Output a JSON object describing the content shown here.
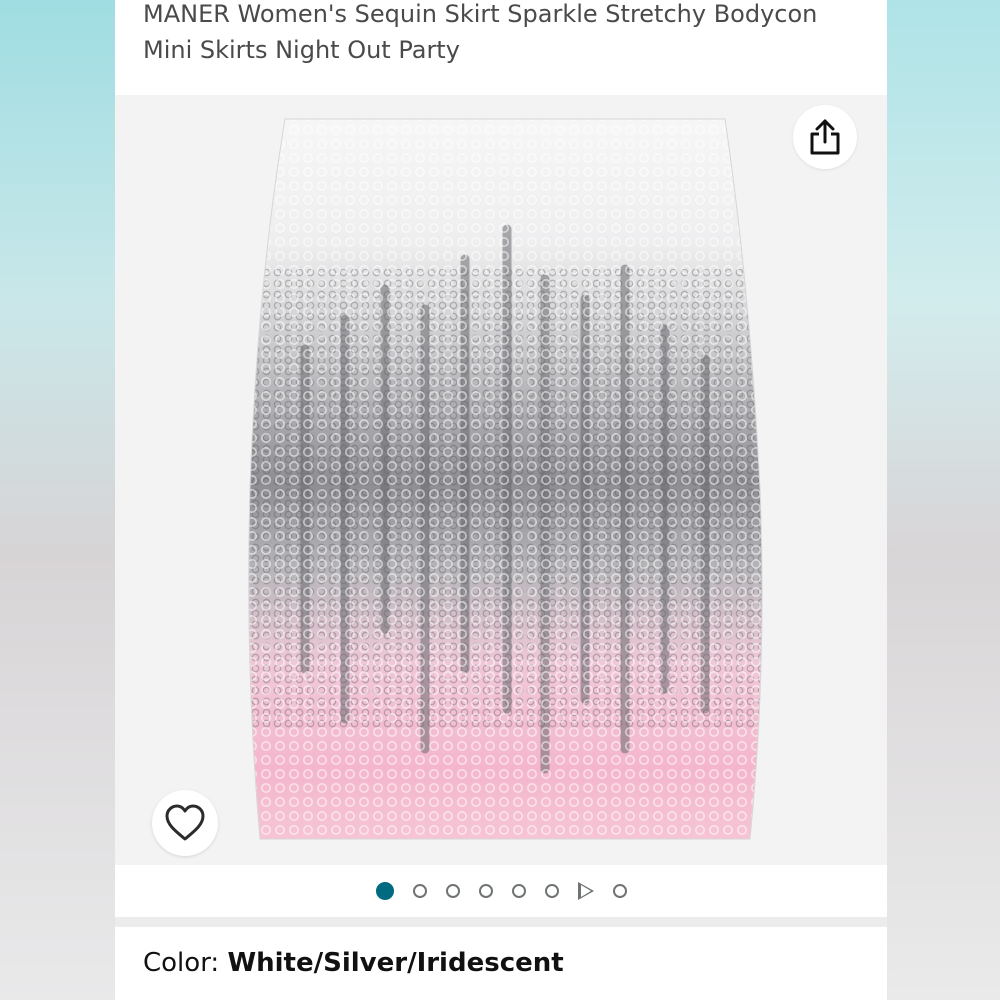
{
  "product": {
    "title": "MANER Women's Sequin Skirt Sparkle Stretchy Bodycon Mini Skirts Night Out Party"
  },
  "gallery": {
    "image_count": 7,
    "active_index": 0,
    "has_video": true,
    "share_icon": "share-icon",
    "wishlist_icon": "heart-outline-icon",
    "active_dot_color": "#006b80"
  },
  "color": {
    "label": "Color:",
    "value": "White/Silver/Iridescent"
  }
}
